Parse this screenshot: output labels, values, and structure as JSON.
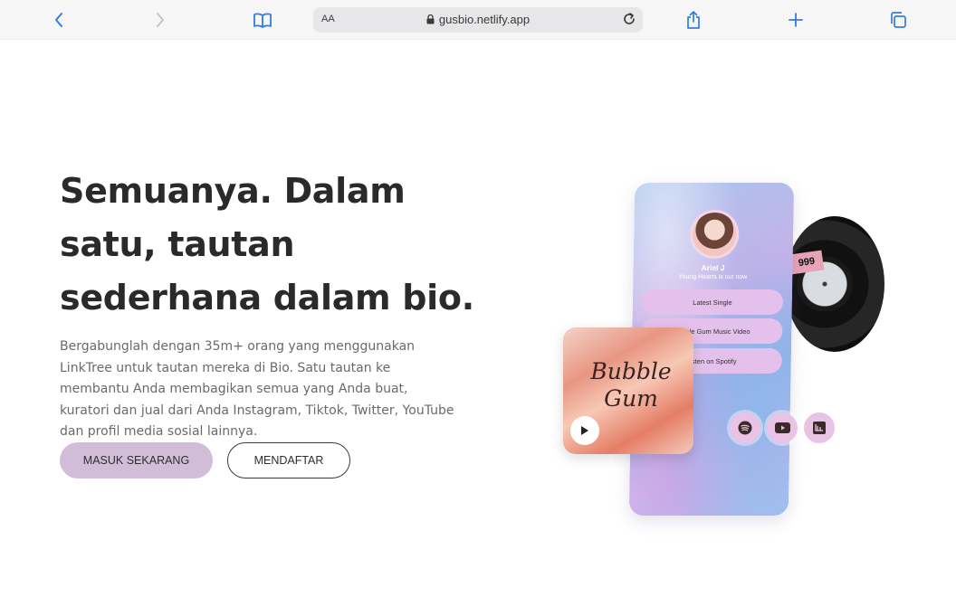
{
  "browser": {
    "url": "gusbio.netlify.app",
    "reader_label": "AA"
  },
  "hero": {
    "headline": "Semuanya. Dalam satu, tautan sederhana dalam bio.",
    "description": "Bergabunglah dengan 35m+ orang yang menggunakan LinkTree untuk tautan mereka di Bio. Satu tautan ke membantu Anda membagikan semua yang Anda buat, kuratori dan jual dari Anda Instagram, Tiktok, Twitter, YouTube dan profil media sosial lainnya.",
    "primary_button": "MASUK SEKARANG",
    "secondary_button": "MENDAFTAR"
  },
  "mockup": {
    "profile_name": "Ariel J",
    "profile_tagline": "Young Hearts is out now",
    "links": [
      "Latest Single",
      "Bubble Gum Music Video",
      "Listen on Spotify"
    ],
    "album_title_line1": "Bubble",
    "album_title_line2": "Gum",
    "vinyl_label": "999",
    "social_icons": [
      "spotify-icon",
      "youtube-icon",
      "bandcamp-icon"
    ]
  },
  "colors": {
    "primary_button_bg": "#d1bdd8",
    "link_button_bg": "#e4c1ec",
    "toolbar_icon": "#2f7de1"
  }
}
